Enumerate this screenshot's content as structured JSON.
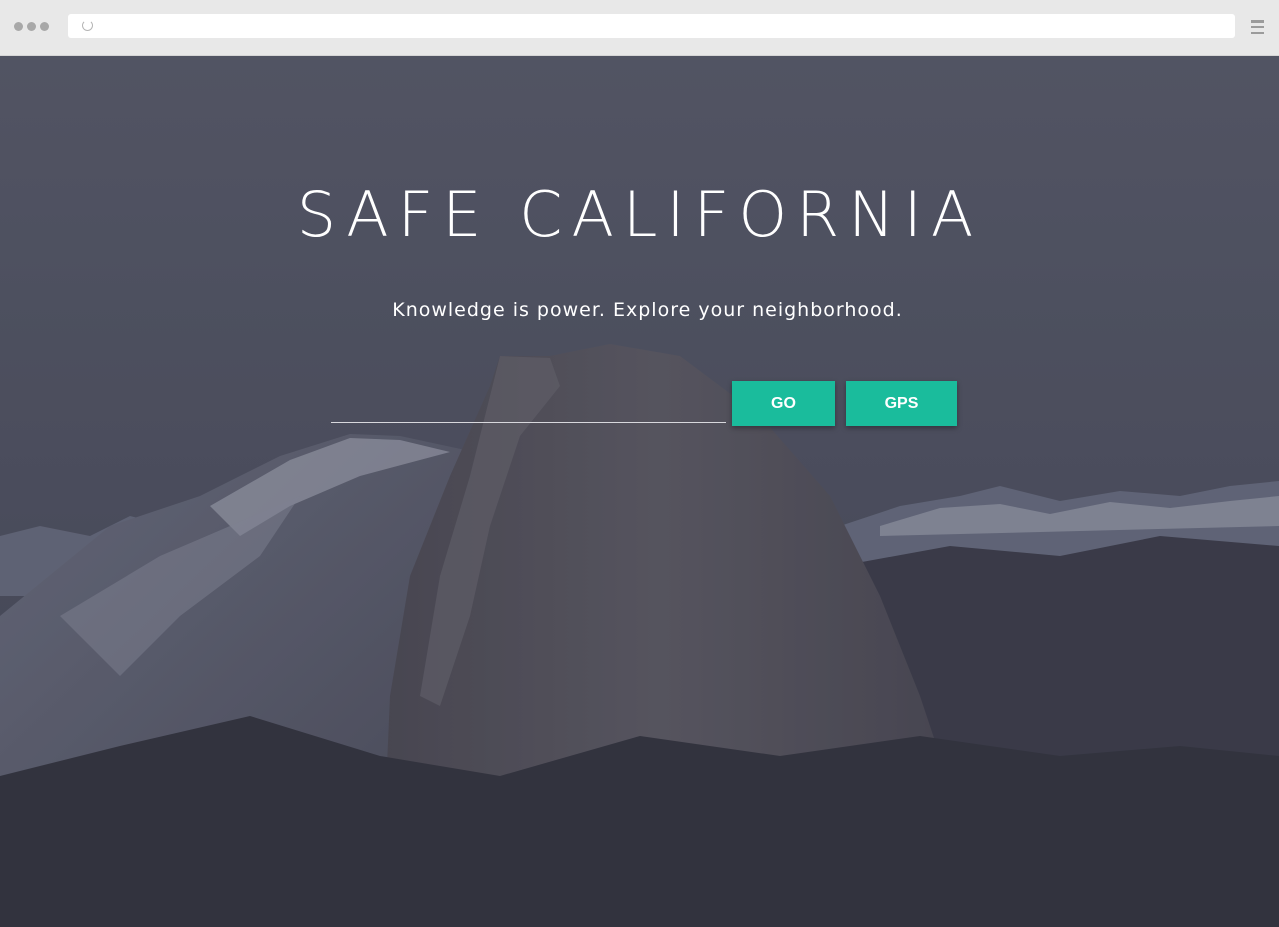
{
  "browser": {
    "url": "",
    "menu_icon": "hamburger-icon",
    "reload_icon": "reload-icon"
  },
  "hero": {
    "title": "SAFE CALIFORNIA",
    "tagline": "Knowledge is power. Explore your neighborhood.",
    "search": {
      "value": "",
      "placeholder": ""
    },
    "go_label": "GO",
    "gps_label": "GPS"
  },
  "colors": {
    "accent": "#1abc9c",
    "overlay": "#3d3e4d",
    "text": "#ffffff"
  }
}
